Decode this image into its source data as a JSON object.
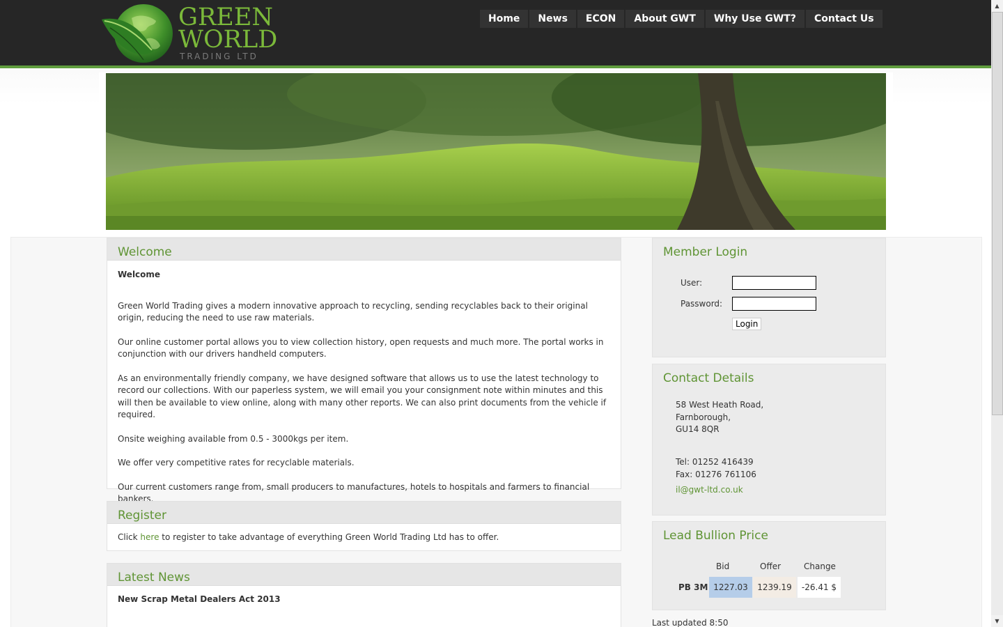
{
  "header": {
    "logo_line1": "GREEN",
    "logo_line2": "WORLD",
    "logo_line3": "TRADING LTD",
    "nav": [
      "Home",
      "News",
      "ECON",
      "About GWT",
      "Why Use GWT?",
      "Contact Us"
    ]
  },
  "welcome": {
    "title": "Welcome",
    "subtitle": "Welcome",
    "paragraphs": [
      "Green World Trading gives a modern innovative approach to recycling, sending recyclables back to their original origin, reducing the need to use raw materials.",
      "Our online customer portal allows you to view collection history, open requests and much more. The portal works in conjunction with our drivers handheld computers.",
      "As an environmentally friendly company, we have designed software that allows us to use the latest technology to record our collections. With our paperless system, we will email you your consignment note within minutes and this will then be available to view online, along with many other reports. We can also print documents from the vehicle if required.",
      "Onsite weighing available from 0.5 - 3000kgs per item.",
      "We offer very competitive rates for recyclable materials.",
      "Our current customers range from, small producers to manufactures, hotels to hospitals and farmers to financial bankers."
    ]
  },
  "register": {
    "title": "Register",
    "text_before": "Click ",
    "link": "here",
    "text_after": " to register to take advantage of everything Green World Trading Ltd has to offer."
  },
  "news": {
    "title": "Latest News",
    "headline": "New Scrap Metal Dealers Act 2013"
  },
  "login": {
    "title": "Member Login",
    "user_label": "User:",
    "password_label": "Password:",
    "button": "Login"
  },
  "contact": {
    "title": "Contact Details",
    "address": [
      "58 West Heath Road,",
      "Farnborough,",
      "GU14 8QR"
    ],
    "tel": "Tel: 01252 416439",
    "fax": "Fax: 01276 761106",
    "email": "il@gwt-ltd.co.uk"
  },
  "bullion": {
    "title": "Lead Bullion Price",
    "headers": [
      "Bid",
      "Offer",
      "Change"
    ],
    "row_label": "PB 3M",
    "bid": "1227.03",
    "offer": "1239.19",
    "change": "-26.41 $",
    "last_updated": "Last updated 8:50"
  },
  "colors": {
    "header_bg": "#262626",
    "accent_green": "#5f9434",
    "bid_bg": "#b5cde9",
    "offer_bg": "#f3ece4"
  }
}
